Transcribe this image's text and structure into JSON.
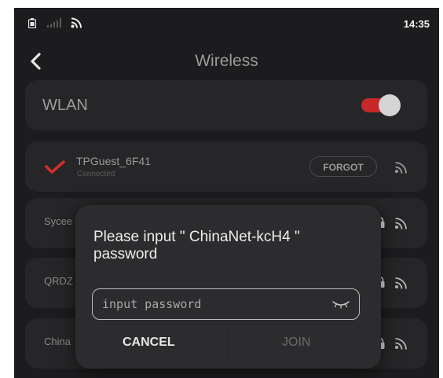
{
  "status_bar": {
    "time": "14:35",
    "icons": [
      "sim-icon",
      "signal-icon",
      "wifi-icon"
    ]
  },
  "header": {
    "title": "Wireless",
    "back_icon": "chevron-left-icon"
  },
  "wlan": {
    "label": "WLAN",
    "enabled": true,
    "accent_color": "#c62828"
  },
  "connected_network": {
    "name": "TPGuest_6F41",
    "status": "Connected",
    "forgot_label": "FORGOT",
    "check_color": "#d32f2f"
  },
  "networks": [
    {
      "label": "Sycee",
      "locked": true
    },
    {
      "label": "QRDZ",
      "locked": true
    },
    {
      "label": "China",
      "locked": true
    }
  ],
  "dialog": {
    "prompt": "Please input \" ChinaNet-kcH4 \" password",
    "password_placeholder": "input password",
    "password_value": "",
    "cancel_label": "CANCEL",
    "join_label": "JOIN"
  }
}
